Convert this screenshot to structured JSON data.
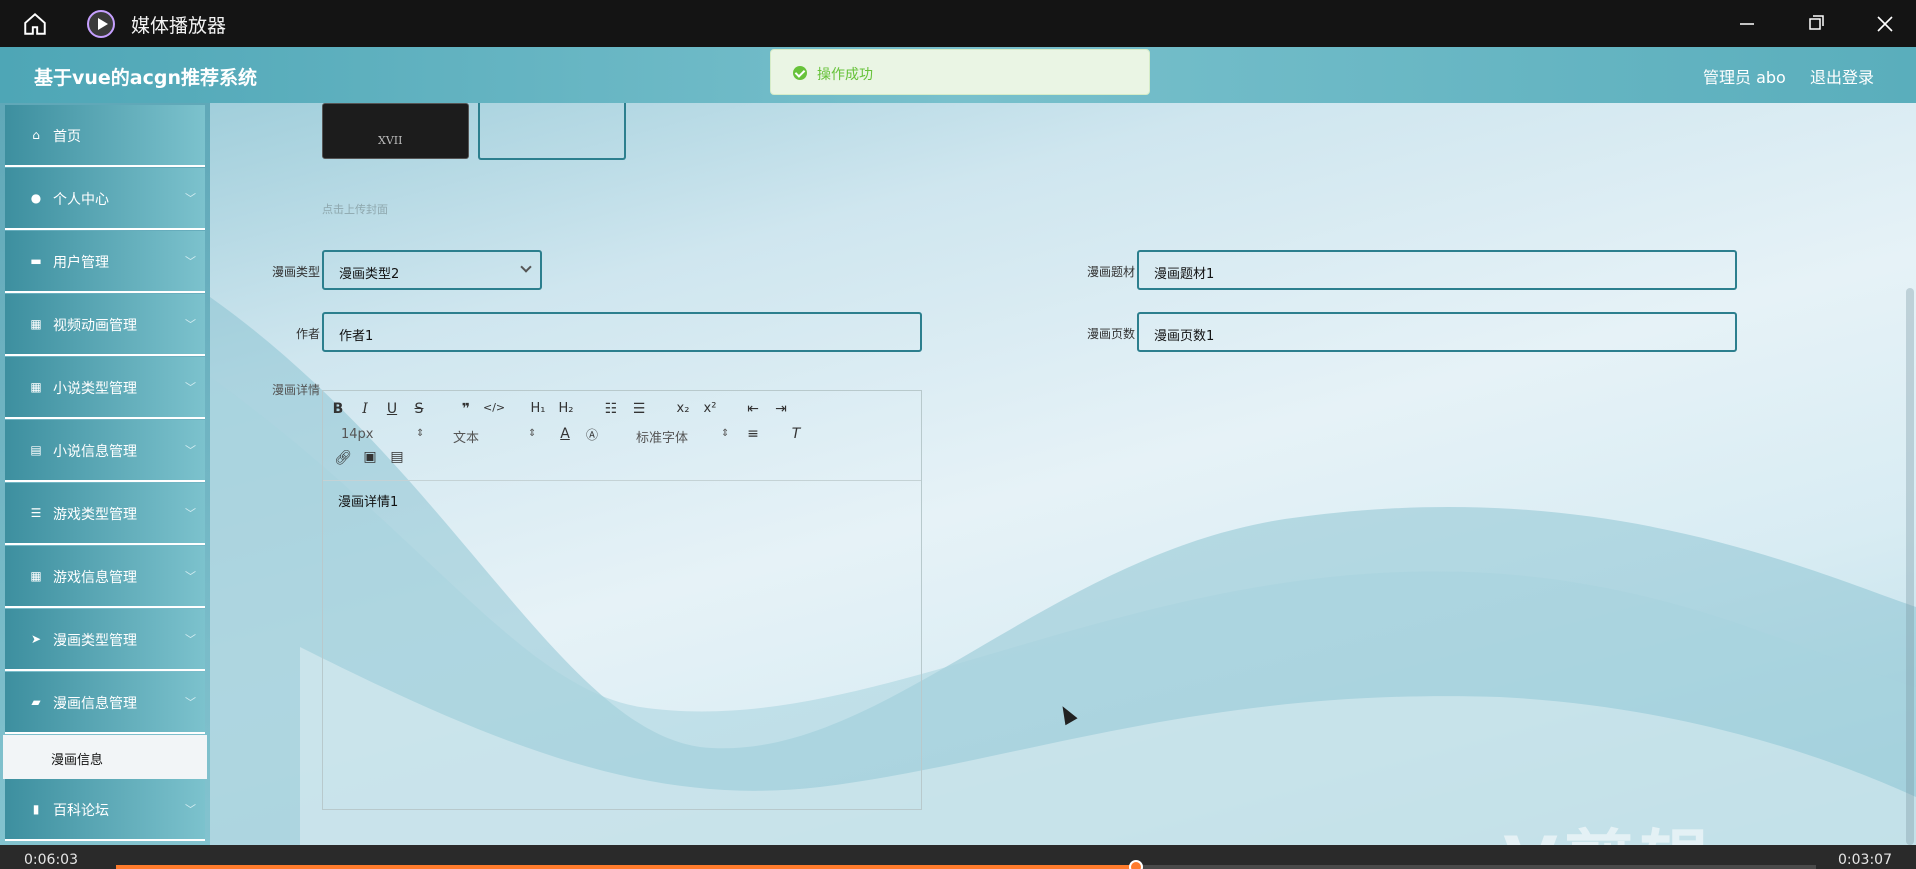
{
  "window": {
    "title": "媒体播放器"
  },
  "header": {
    "brand": "基于vue的acgn推荐系统",
    "user": "管理员 abo",
    "logout": "退出登录"
  },
  "toast": {
    "text": "操作成功",
    "color": "#67c23a"
  },
  "sidebar": {
    "items": [
      {
        "label": "首页",
        "icon": "home-icon",
        "has_arrow": false
      },
      {
        "label": "个人中心",
        "icon": "user-icon",
        "has_arrow": true
      },
      {
        "label": "用户管理",
        "icon": "monitor-icon",
        "has_arrow": true
      },
      {
        "label": "视频动画管理",
        "icon": "grid-icon",
        "has_arrow": true
      },
      {
        "label": "小说类型管理",
        "icon": "grid-icon",
        "has_arrow": true
      },
      {
        "label": "小说信息管理",
        "icon": "clipboard-icon",
        "has_arrow": true
      },
      {
        "label": "游戏类型管理",
        "icon": "list-icon",
        "has_arrow": true
      },
      {
        "label": "游戏信息管理",
        "icon": "grid-icon",
        "has_arrow": true
      },
      {
        "label": "漫画类型管理",
        "icon": "send-icon",
        "has_arrow": true
      },
      {
        "label": "漫画信息管理",
        "icon": "ticket-icon",
        "has_arrow": true
      },
      {
        "label": "百科论坛",
        "icon": "chart-icon",
        "has_arrow": true
      }
    ],
    "active_sub": "漫画信息"
  },
  "form": {
    "cover_hint": "点击上传封面",
    "type_label": "漫画类型",
    "type_value": "漫画类型2",
    "theme_label": "漫画题材",
    "theme_value": "漫画题材1",
    "author_label": "作者",
    "author_value": "作者1",
    "pages_label": "漫画页数",
    "pages_value": "漫画页数1",
    "detail_label": "漫画详情",
    "detail_value": "漫画详情1"
  },
  "editor": {
    "font_size": "14px",
    "text_style": "文本",
    "font_family": "标准字体"
  },
  "player": {
    "time_left": "0:06:03",
    "time_right": "0:03:07",
    "progress": 0.6
  },
  "watermark": "eV剪辑"
}
